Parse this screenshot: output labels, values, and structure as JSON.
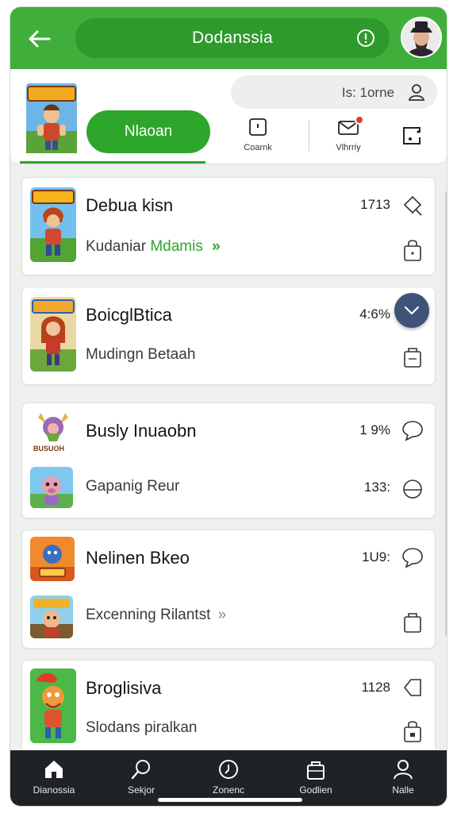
{
  "app": {
    "title": "Dodanssia",
    "colors": {
      "primary": "#3fae3a",
      "primary_dark": "#2f9a2c",
      "accent": "#2ea52b",
      "nav_bg": "#1f2227",
      "fab": "#3e5378"
    }
  },
  "header": {
    "search_text": "Is: 1orne",
    "primary_button": "Nlaoan",
    "actions": [
      {
        "label": "Coarnk",
        "icon": "note-icon"
      },
      {
        "label": "Vlhrriy",
        "icon": "envelope-icon"
      },
      {
        "label": "",
        "icon": "scan-icon"
      }
    ]
  },
  "list": [
    {
      "title": "Debua kisn",
      "subtitle": "Kudaniar",
      "subtitle_link": "Mdamis",
      "value": "1713",
      "value2": ""
    },
    {
      "title": "BoicglBtica",
      "subtitle": "Mudingn Betaah",
      "subtitle_link": "",
      "value": "4:6%",
      "value2": ""
    },
    {
      "title": "Busly Inuaobn",
      "subtitle": "Gapanig Reur",
      "subtitle_link": "",
      "value": "1 9%",
      "value2": "133:"
    },
    {
      "title": "Nelinen Bkeo",
      "subtitle": "Excenning Rilantst",
      "subtitle_link": "",
      "value": "1U9:",
      "value2": ""
    },
    {
      "title": "Broglisiva",
      "subtitle": "Slodans piralkan",
      "subtitle_link": "",
      "value": "1128",
      "value2": ""
    }
  ],
  "thumb_labels": {
    "item3_small": "BUSUOH"
  },
  "bottom_nav": [
    {
      "label": "Dianossia",
      "icon": "home-icon"
    },
    {
      "label": "Sekjor",
      "icon": "search-icon"
    },
    {
      "label": "Zonenc",
      "icon": "clock-icon"
    },
    {
      "label": "Godlien",
      "icon": "bag-icon"
    },
    {
      "label": "Nalle",
      "icon": "profile-icon"
    }
  ]
}
